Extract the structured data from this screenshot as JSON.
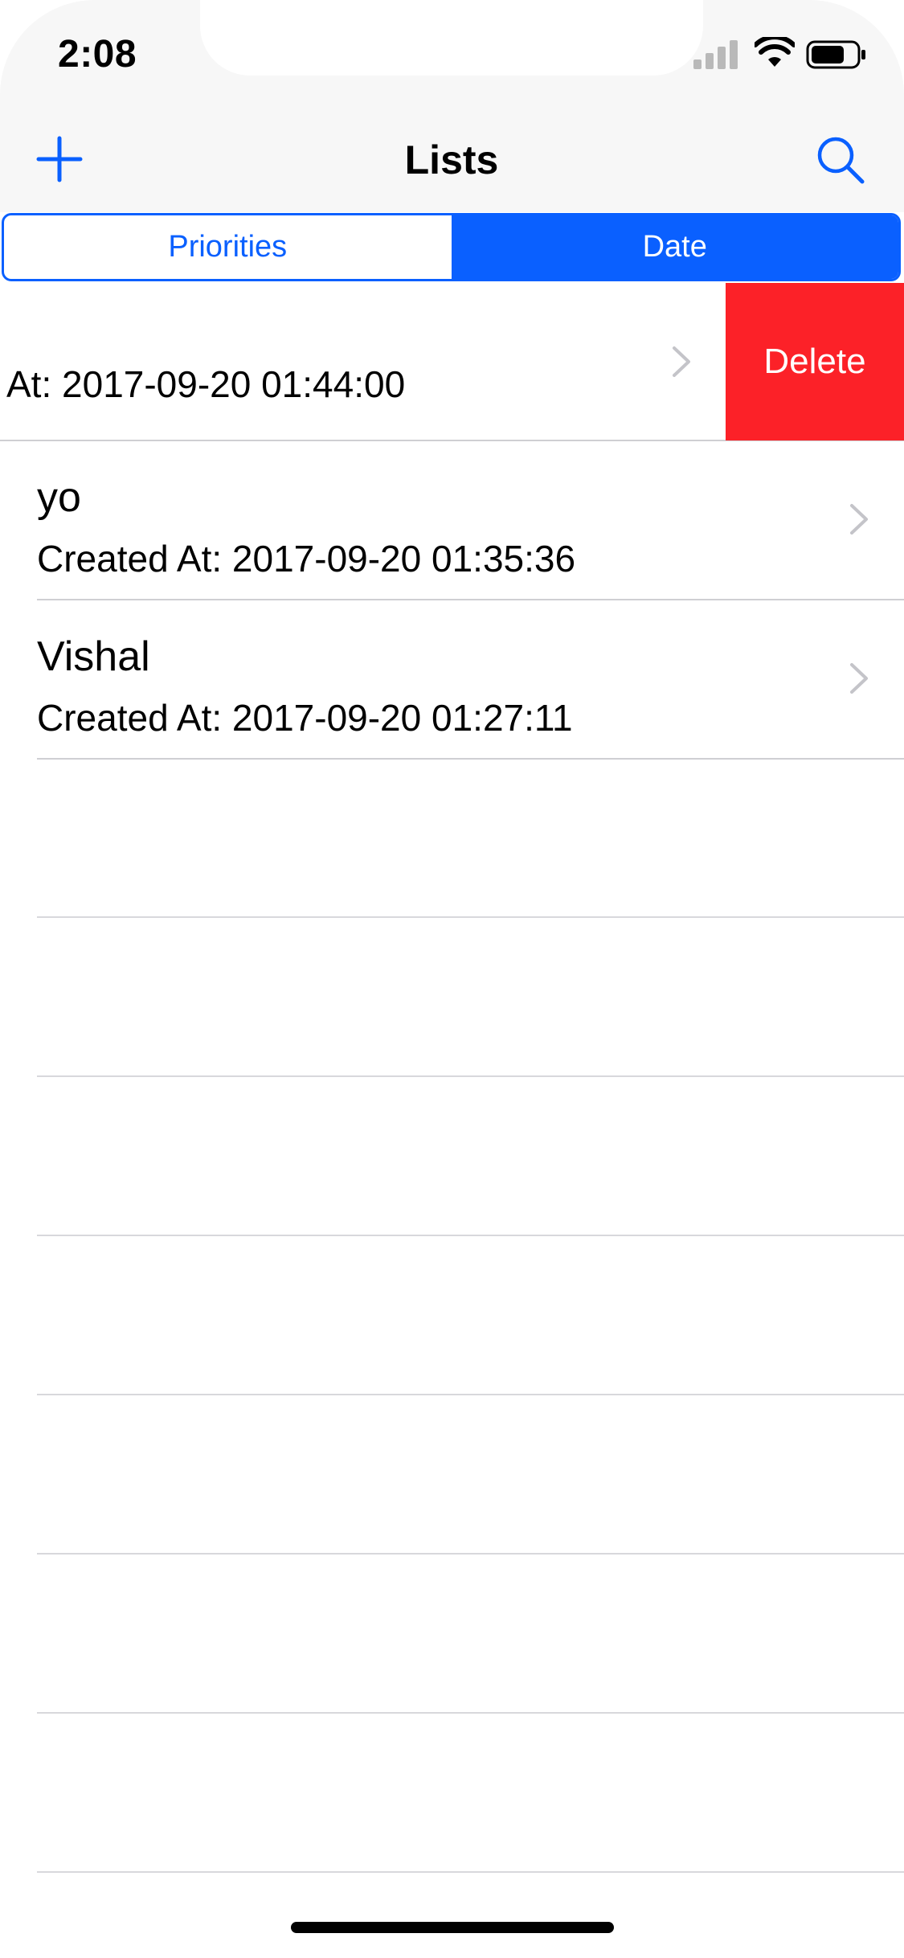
{
  "status_bar": {
    "time": "2:08",
    "signal_icon": "cellular-signal-icon",
    "wifi_icon": "wifi-icon",
    "battery_icon": "battery-icon"
  },
  "nav": {
    "title": "Lists",
    "add_icon": "plus-icon",
    "search_icon": "search-icon"
  },
  "segments": [
    {
      "label": "Priorities",
      "selected": false
    },
    {
      "label": "Date",
      "selected": true
    }
  ],
  "rows": [
    {
      "title": "",
      "subtitle": "At: 2017-09-20 01:44:00",
      "swiped": true
    },
    {
      "title": "yo",
      "subtitle": "Created At: 2017-09-20 01:35:36",
      "swiped": false
    },
    {
      "title": "Vishal",
      "subtitle": "Created At: 2017-09-20 01:27:11",
      "swiped": false
    }
  ],
  "swipe_action": {
    "label": "Delete",
    "color": "#fc2128"
  },
  "colors": {
    "accent": "#0a60ff",
    "separator": "#cfcfd3",
    "nav_background": "#f7f7f7"
  }
}
